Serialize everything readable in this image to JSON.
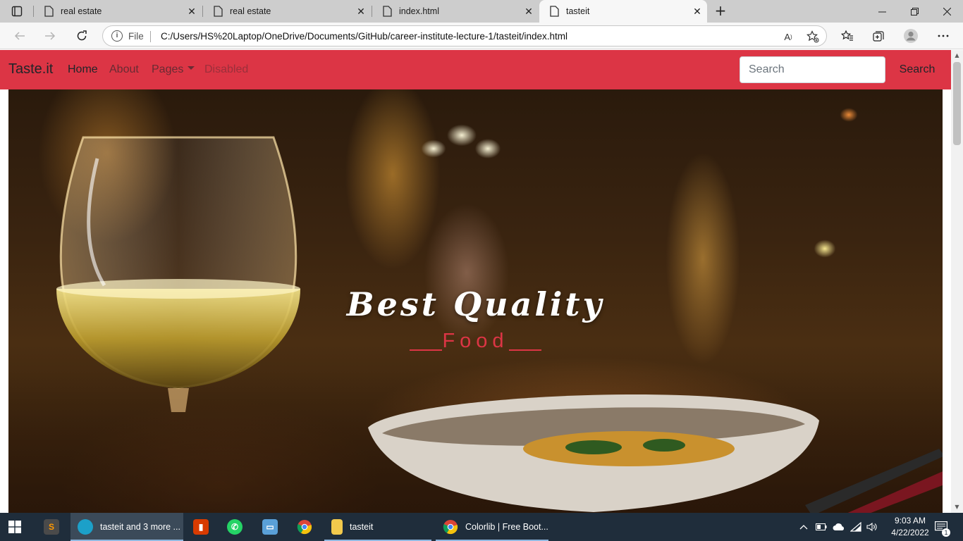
{
  "browser": {
    "tabs": [
      {
        "label": "real estate",
        "active": false
      },
      {
        "label": "real estate",
        "active": false
      },
      {
        "label": "index.html",
        "active": false
      },
      {
        "label": "tasteit",
        "active": true
      }
    ],
    "address": {
      "scheme_label": "File",
      "url": "C:/Users/HS%20Laptop/OneDrive/Documents/GitHub/career-institute-lecture-1/tasteit/index.html"
    }
  },
  "site": {
    "brand": "Taste.it",
    "nav": {
      "home": "Home",
      "about": "About",
      "pages": "Pages",
      "disabled": "Disabled"
    },
    "search": {
      "placeholder": "Search",
      "button": "Search"
    },
    "accent_color": "#dc3545",
    "hero": {
      "headline": "Best Quality",
      "subline": "Food"
    }
  },
  "taskbar": {
    "apps": [
      {
        "label": "tasteit and 3 more ...",
        "icon": "edge-icon",
        "active": true
      },
      {
        "label": "tasteit",
        "icon": "folder-icon",
        "active": false
      },
      {
        "label": "Colorlib | Free Boot...",
        "icon": "chrome-icon",
        "active": false
      }
    ],
    "clock": {
      "time": "9:03 AM",
      "date": "4/22/2022"
    },
    "notification_count": "1"
  }
}
